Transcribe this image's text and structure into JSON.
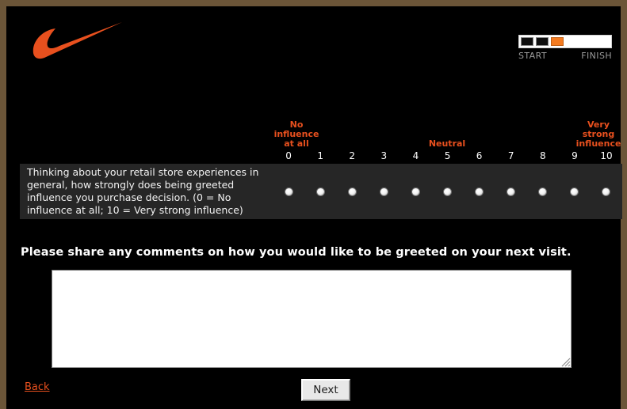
{
  "brand": {
    "logo_icon": "nike-swoosh-icon",
    "logo_color": "#e8501e"
  },
  "progress": {
    "segments_total": 3,
    "segments_completed": 2,
    "current_segment_index": 3,
    "start_label": "START",
    "finish_label": "FINISH",
    "fill_color": "#f47b20",
    "done_color": "#0f0f0f",
    "track_color": "#ffffff"
  },
  "scale": {
    "anchor_low": "No\ninfluence\nat all",
    "anchor_low_lines": [
      "No",
      "influence",
      "at all"
    ],
    "anchor_mid": "Neutral",
    "anchor_high_lines": [
      "Very",
      "strong",
      "influence"
    ],
    "anchor_color": "#e8501e",
    "numbers": [
      "0",
      "1",
      "2",
      "3",
      "4",
      "5",
      "6",
      "7",
      "8",
      "9",
      "10"
    ],
    "selected_value": null
  },
  "question": {
    "text": "Thinking about your retail store experiences in general, how strongly does being greeted influence you purchase decision. (0 = No influence at all; 10 = Very strong influence)",
    "panel_color": "#262626"
  },
  "comment": {
    "prompt": "Please share any comments on how you would like to be greeted on your next visit.",
    "value": "",
    "placeholder": ""
  },
  "footer": {
    "back_label": "Back",
    "next_label": "Next",
    "back_color": "#e8501e"
  }
}
